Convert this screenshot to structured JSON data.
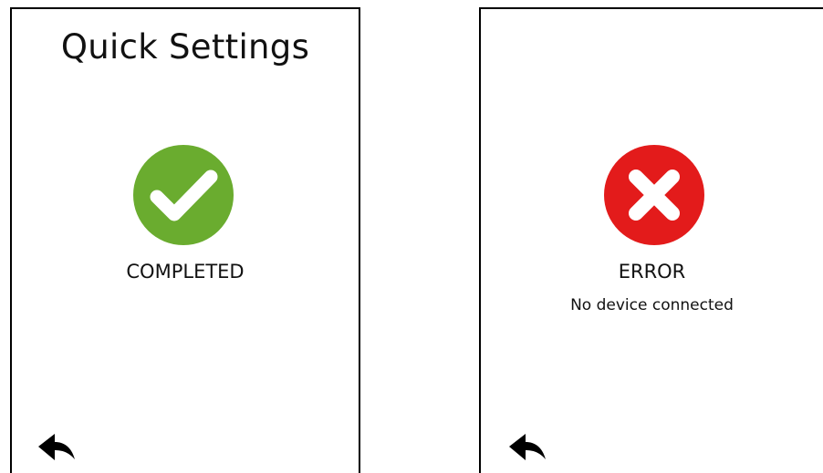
{
  "screens": {
    "left": {
      "title": "Quick Settings",
      "status": "COMPLETED",
      "icon": "checkmark-circle-icon",
      "icon_color": "#6aac2f",
      "back_icon": "back-arrow-icon"
    },
    "right": {
      "status": "ERROR",
      "detail": "No device connected",
      "icon": "x-circle-icon",
      "icon_color": "#e31b1b",
      "back_icon": "back-arrow-icon"
    }
  },
  "colors": {
    "background": "#ffffff",
    "border": "#000000",
    "text": "#111111",
    "success": "#6aac2f",
    "error": "#e31b1b"
  }
}
